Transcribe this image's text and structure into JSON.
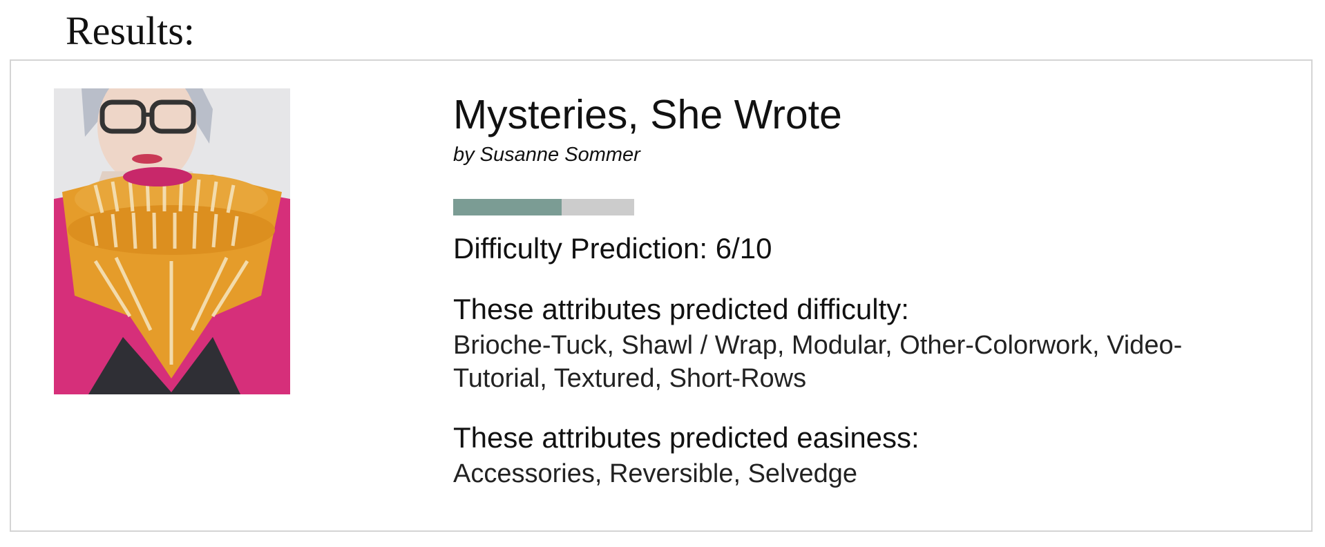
{
  "page": {
    "heading": "Results:"
  },
  "result": {
    "photo_alt": "Person wearing a pink and orange brioche shawl",
    "title": "Mysteries, She Wrote",
    "author": "by Susanne Sommer",
    "difficulty_score": 6,
    "difficulty_max": 10,
    "difficulty_fraction": 0.6,
    "difficulty_label": "Difficulty Prediction: 6/10",
    "difficulty_attributes_heading": "These attributes predicted difficulty:",
    "difficulty_attributes": "Brioche-Tuck, Shawl / Wrap, Modular, Other-Colorwork, Video-Tutorial, Textured, Short-Rows",
    "easiness_attributes_heading": "These attributes predicted easiness:",
    "easiness_attributes": "Accessories, Reversible, Selvedge"
  },
  "colors": {
    "bar_fill": "#7b9c94",
    "bar_track": "#cccccc",
    "card_border": "#d4d4d4"
  }
}
